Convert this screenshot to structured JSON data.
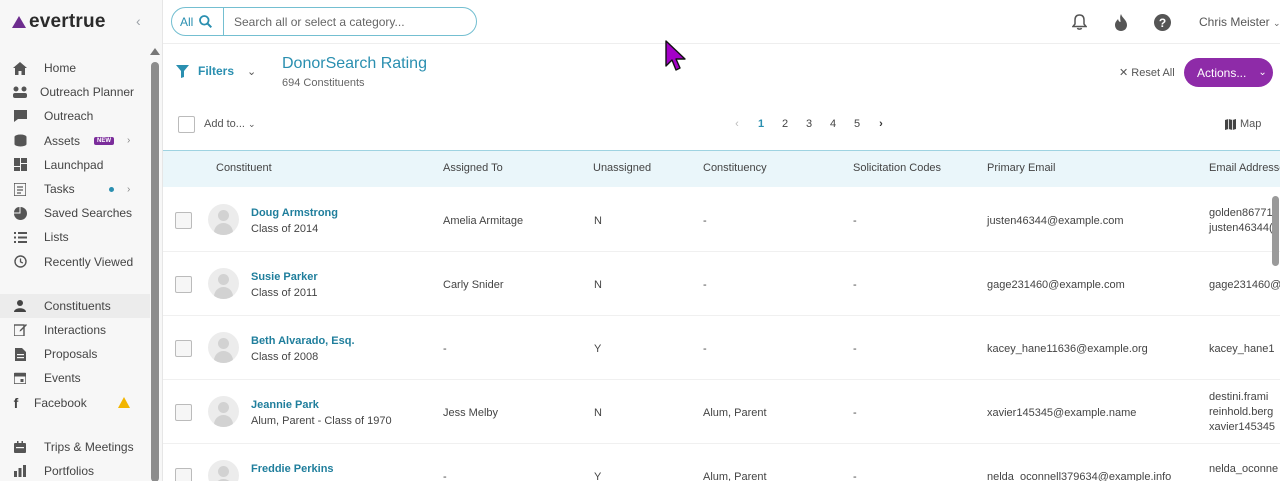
{
  "brand": {
    "name": "evertrue"
  },
  "sidebar": {
    "items": [
      {
        "label": "Home",
        "icon": "home-icon"
      },
      {
        "label": "Outreach Planner",
        "icon": "planner-icon",
        "chevron": true
      },
      {
        "label": "Outreach",
        "icon": "chat-icon"
      },
      {
        "label": "Assets",
        "icon": "assets-icon",
        "badge": "NEW",
        "chevron": true
      },
      {
        "label": "Launchpad",
        "icon": "dashboard-icon"
      },
      {
        "label": "Tasks",
        "icon": "tasks-icon",
        "dot": true,
        "chevron": true
      },
      {
        "label": "Saved Searches",
        "icon": "pie-icon"
      },
      {
        "label": "Lists",
        "icon": "list-icon"
      },
      {
        "label": "Recently Viewed",
        "icon": "history-icon"
      },
      {
        "label": "Constituents",
        "icon": "person-icon",
        "active": true
      },
      {
        "label": "Interactions",
        "icon": "edit-icon"
      },
      {
        "label": "Proposals",
        "icon": "document-icon"
      },
      {
        "label": "Events",
        "icon": "calendar-icon"
      },
      {
        "label": "Facebook",
        "icon": "facebook-icon",
        "warning": true
      },
      {
        "label": "Trips & Meetings",
        "icon": "trips-icon"
      },
      {
        "label": "Portfolios",
        "icon": "portfolio-icon"
      }
    ]
  },
  "search": {
    "scope": "All",
    "placeholder": "Search all or select a category..."
  },
  "user": {
    "name": "Chris Meister"
  },
  "header": {
    "filters_label": "Filters",
    "title": "DonorSearch Rating",
    "count": "694 Constituents",
    "reset_label": "Reset All",
    "actions_label": "Actions..."
  },
  "toolbar": {
    "add_to_label": "Add to...",
    "pages": [
      "1",
      "2",
      "3",
      "4",
      "5"
    ],
    "current_page": "1",
    "map_label": "Map"
  },
  "table": {
    "columns": [
      "Constituent",
      "Assigned To",
      "Unassigned",
      "Constituency",
      "Solicitation Codes",
      "Primary Email",
      "Email Addresses"
    ],
    "rows": [
      {
        "name": "Doug Armstrong",
        "sub": "Class of 2014",
        "assigned": "Amelia Armitage",
        "unassigned": "N",
        "constituency": "-",
        "codes": "-",
        "email": "justen46344@example.com",
        "emails": [
          "golden86771",
          "justen46344("
        ]
      },
      {
        "name": "Susie Parker",
        "sub": "Class of 2011",
        "assigned": "Carly Snider",
        "unassigned": "N",
        "constituency": "-",
        "codes": "-",
        "email": "gage231460@example.com",
        "emails": [
          "gage231460@"
        ]
      },
      {
        "name": "Beth Alvarado, Esq.",
        "sub": "Class of 2008",
        "assigned": "-",
        "unassigned": "Y",
        "constituency": "-",
        "codes": "-",
        "email": "kacey_hane11636@example.org",
        "emails": [
          "kacey_hane1"
        ]
      },
      {
        "name": "Jeannie Park",
        "sub": "Alum, Parent - Class of 1970",
        "assigned": "Jess Melby",
        "unassigned": "N",
        "constituency": "Alum, Parent",
        "codes": "-",
        "email": "xavier145345@example.name",
        "emails": [
          "destini.frami",
          "reinhold.berg",
          "xavier145345"
        ]
      },
      {
        "name": "Freddie Perkins",
        "sub": "",
        "assigned": "-",
        "unassigned": "Y",
        "constituency": "Alum, Parent",
        "codes": "-",
        "email": "nelda_oconnell379634@example.info",
        "emails": [
          "nelda_oconne"
        ]
      }
    ]
  },
  "colors": {
    "accent": "#2a8fb0",
    "brand": "#8e2ba8",
    "header_bg": "#eaf6fa"
  }
}
